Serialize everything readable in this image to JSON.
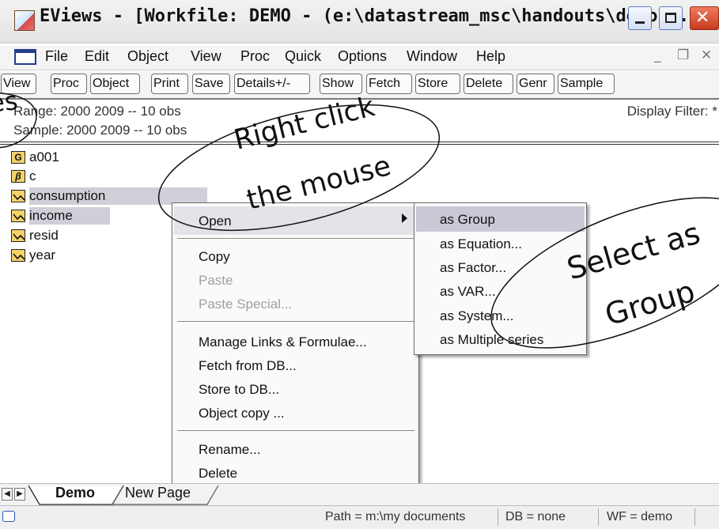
{
  "window": {
    "title": "EViews - [Workfile: DEMO - (e:\\datastream_msc\\handouts\\demo...."
  },
  "menubar": {
    "items": [
      "File",
      "Edit",
      "Object",
      "View",
      "Proc",
      "Quick",
      "Options",
      "Window",
      "Help"
    ]
  },
  "toolbar": {
    "buttons": [
      "View",
      "Proc",
      "Object",
      "Print",
      "Save",
      "Details+/-",
      "Show",
      "Fetch",
      "Store",
      "Delete",
      "Genr",
      "Sample"
    ]
  },
  "workfile": {
    "range": "Range:  2000 2009  --  10 obs",
    "sample": "Sample: 2000 2009  --  10 obs",
    "display_filter": "Display Filter: *"
  },
  "objects": [
    {
      "name": "a001",
      "icon": "G",
      "type": "group-icon"
    },
    {
      "name": "c",
      "icon": "β",
      "type": "coefficient-icon"
    },
    {
      "name": "consumption",
      "icon": "",
      "type": "series-icon",
      "selected": true
    },
    {
      "name": "income",
      "icon": "",
      "type": "series-icon",
      "selected": true
    },
    {
      "name": "resid",
      "icon": "",
      "type": "series-icon"
    },
    {
      "name": "year",
      "icon": "",
      "type": "series-icon"
    }
  ],
  "context_menu": {
    "open": "Open",
    "copy": "Copy",
    "paste": "Paste",
    "paste_special": "Paste Special...",
    "manage_links": "Manage Links & Formulae...",
    "fetch_db": "Fetch from DB...",
    "store_db": "Store to DB...",
    "object_copy": "Object copy ...",
    "rename": "Rename...",
    "delete": "Delete"
  },
  "submenu": {
    "items": [
      "as Group",
      "as Equation...",
      "as Factor...",
      "as VAR...",
      "as System...",
      "as Multiple series"
    ],
    "highlighted": "as Group"
  },
  "tabs": {
    "items": [
      "Demo",
      "New Page"
    ]
  },
  "statusbar": {
    "path": "Path = m:\\my documents",
    "db": "DB = none",
    "wf": "WF = demo"
  },
  "annotations": {
    "left_fragment": "es",
    "right_click_line1": "Right click",
    "right_click_line2": "the mouse",
    "select_line1": "Select as",
    "select_line2": "Group"
  },
  "colors": {
    "selection": "#cfcfd8",
    "submenu_highlight": "#c9c9d6",
    "series_icon": "#f3d26a",
    "close_button": "#d9502f"
  }
}
